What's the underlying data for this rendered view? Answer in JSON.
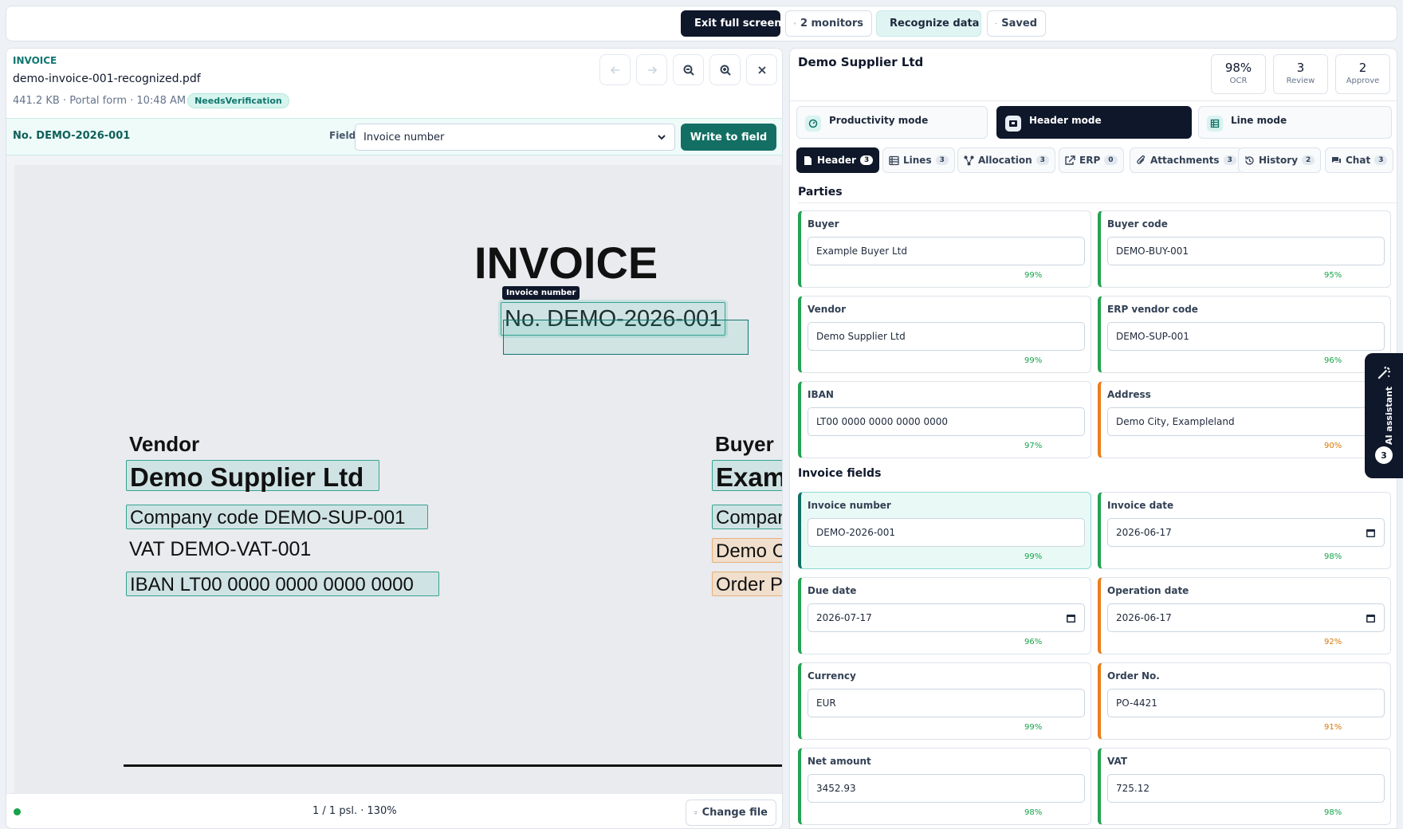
{
  "toolbar": {
    "exit_fullscreen": "Exit full screen",
    "monitors": "2 monitors",
    "recognize": "Recognize data",
    "saved": "Saved"
  },
  "file": {
    "doc_type": "INVOICE",
    "name": "demo-invoice-001-recognized.pdf",
    "meta": "441.2 KB · Portal form · 10:48 AM",
    "status_badge": "NeedsVerification"
  },
  "field_bar": {
    "value": "No. DEMO-2026-001",
    "label": "Field",
    "selected_field": "Invoice number",
    "write_button": "Write to field"
  },
  "document": {
    "title": "INVOICE",
    "number": "No. DEMO-2026-001",
    "tooltip": "Invoice number",
    "vendor_heading": "Vendor",
    "vendor_name": "Demo Supplier Ltd",
    "vendor_code": "Company code DEMO-SUP-001",
    "vendor_vat": "VAT DEMO-VAT-001",
    "vendor_iban": "IBAN LT00 0000 0000 0000 0000",
    "buyer_heading": "Buyer",
    "buyer_name": "Exam",
    "buyer_code": "Compan",
    "buyer_city": "Demo C",
    "buyer_order": "Order P"
  },
  "footer": {
    "page_info": "1 / 1 psl. · 130%",
    "change_file": "Change file"
  },
  "panel": {
    "supplier": "Demo Supplier Ltd",
    "stats": [
      {
        "value": "98%",
        "label": "OCR"
      },
      {
        "value": "3",
        "label": "Review"
      },
      {
        "value": "2",
        "label": "Approve"
      }
    ],
    "modes": [
      "Productivity mode",
      "Header mode",
      "Line mode"
    ],
    "tabs": [
      {
        "label": "Header",
        "count": "3"
      },
      {
        "label": "Lines",
        "count": "3"
      },
      {
        "label": "Allocation",
        "count": "3"
      },
      {
        "label": "ERP",
        "count": "0"
      },
      {
        "label": "Attachments",
        "count": "3"
      },
      {
        "label": "History",
        "count": "2"
      },
      {
        "label": "Chat",
        "count": "3"
      }
    ],
    "parties_title": "Parties",
    "invoice_fields_title": "Invoice fields",
    "parties": [
      {
        "label": "Buyer",
        "value": "Example Buyer Ltd",
        "conf": "99%"
      },
      {
        "label": "Buyer code",
        "value": "DEMO-BUY-001",
        "conf": "95%"
      },
      {
        "label": "Vendor",
        "value": "Demo Supplier Ltd",
        "conf": "99%"
      },
      {
        "label": "ERP vendor code",
        "value": "DEMO-SUP-001",
        "conf": "96%"
      },
      {
        "label": "IBAN",
        "value": "LT00 0000 0000 0000 0000",
        "conf": "97%"
      },
      {
        "label": "Address",
        "value": "Demo City, Exampleland",
        "conf": "90%"
      }
    ],
    "invoice_fields": [
      {
        "label": "Invoice number",
        "value": "DEMO-2026-001",
        "conf": "99%"
      },
      {
        "label": "Invoice date",
        "value": "2026-06-17",
        "conf": "98%"
      },
      {
        "label": "Due date",
        "value": "2026-07-17",
        "conf": "96%"
      },
      {
        "label": "Operation date",
        "value": "2026-06-17",
        "conf": "92%"
      },
      {
        "label": "Currency",
        "value": "EUR",
        "conf": "99%"
      },
      {
        "label": "Order No.",
        "value": "PO-4421",
        "conf": "91%"
      },
      {
        "label": "Net amount",
        "value": "3452.93",
        "conf": "98%"
      },
      {
        "label": "VAT",
        "value": "725.12",
        "conf": "98%"
      }
    ]
  },
  "ai_assistant": {
    "label": "AI assistant",
    "count": "3"
  },
  "colors": {
    "accent": "#136f63",
    "dark": "#0f172a",
    "ok": "#22a352",
    "warn": "#ea7f1c"
  }
}
